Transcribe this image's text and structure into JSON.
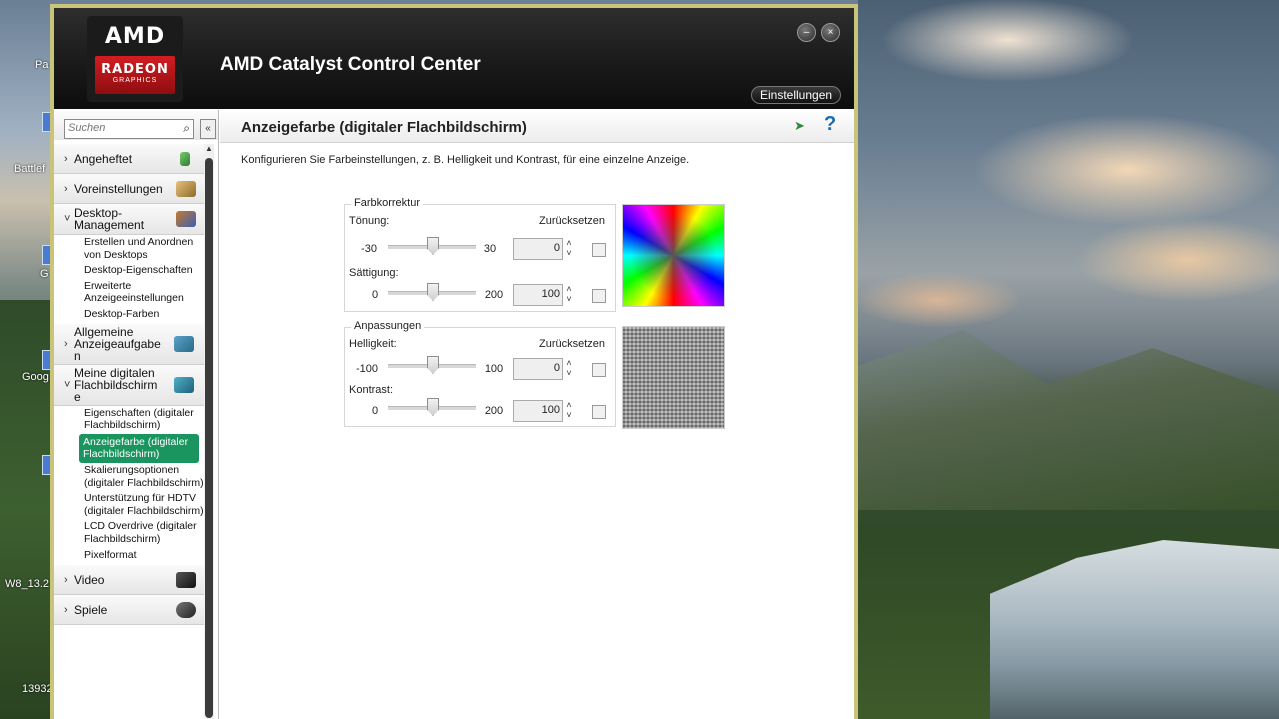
{
  "desktop": {
    "labels": [
      "Pa",
      "Battlef",
      "G",
      "Goog",
      "W8_13.2",
      "13932"
    ]
  },
  "window": {
    "logo_amd": "AMD",
    "logo_radeon": "RADEON",
    "logo_graphics": "GRAPHICS",
    "title": "AMD Catalyst Control Center",
    "minimize_symbol": "–",
    "close_symbol": "×",
    "settings_label": "Einstellungen"
  },
  "sidebar": {
    "search_placeholder": "Suchen",
    "collapse_symbol": "«",
    "categories": [
      {
        "label": "Angeheftet",
        "chev": "›",
        "icon": "pin-icon"
      },
      {
        "label": "Voreinstellungen",
        "chev": "›",
        "icon": "presets-icon"
      },
      {
        "label": "Desktop-\nManagement",
        "chev": "˅",
        "icon": "desktop-management-icon",
        "items": [
          "Erstellen und Anordnen von Desktops",
          "Desktop-Eigenschaften",
          "Erweiterte Anzeigeeinstellungen",
          "Desktop-Farben"
        ]
      },
      {
        "label": "Allgemeine Anzeigeaufgabe n",
        "chev": "›",
        "icon": "display-tasks-icon"
      },
      {
        "label": "Meine digitalen Flachbildschirm e",
        "chev": "˅",
        "icon": "flat-panel-icon",
        "items": [
          "Eigenschaften (digitaler Flachbildschirm)",
          "Anzeigefarbe (digitaler Flachbildschirm)",
          "Skalierungsoptionen (digitaler Flachbildschirm)",
          "Unterstützung für HDTV (digitaler Flachbildschirm)",
          "LCD Overdrive (digitaler Flachbildschirm)",
          "Pixelformat"
        ]
      },
      {
        "label": "Video",
        "chev": "›",
        "icon": "video-camera-icon"
      },
      {
        "label": "Spiele",
        "chev": "›",
        "icon": "gamepad-icon"
      }
    ],
    "active_item": "Anzeigefarbe (digitaler Flachbildschirm)"
  },
  "main": {
    "title": "Anzeigefarbe (digitaler Flachbildschirm)",
    "help_symbol": "?",
    "description": "Konfigurieren Sie Farbeinstellungen, z. B. Helligkeit und Kontrast, für eine einzelne Anzeige.",
    "color_group": {
      "legend": "Farbkorrektur",
      "reset": "Zurücksetzen",
      "hue": {
        "label": "Tönung:",
        "min": "-30",
        "max": "30",
        "value": "0",
        "position": 0.5
      },
      "saturation": {
        "label": "Sättigung:",
        "min": "0",
        "max": "200",
        "value": "100",
        "position": 0.5
      }
    },
    "adjust_group": {
      "legend": "Anpassungen",
      "reset": "Zurücksetzen",
      "brightness": {
        "label": "Helligkeit:",
        "min": "-100",
        "max": "100",
        "value": "0",
        "position": 0.5
      },
      "contrast": {
        "label": "Kontrast:",
        "min": "0",
        "max": "200",
        "value": "100",
        "position": 0.5
      }
    }
  }
}
